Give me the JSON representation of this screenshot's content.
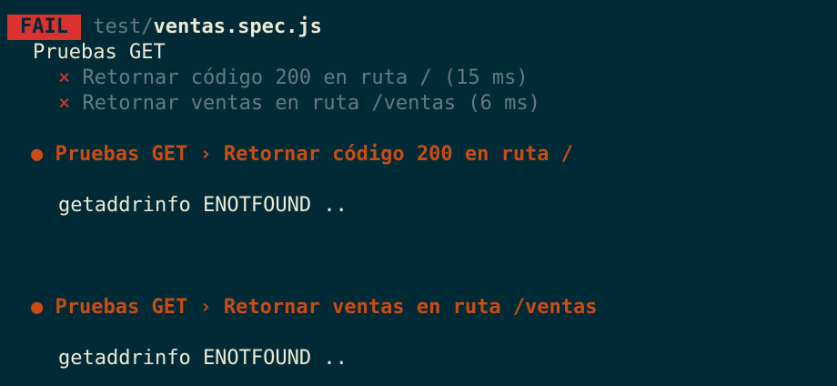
{
  "header": {
    "status_badge": "FAIL",
    "file_dir": "test/",
    "file_name": "ventas.spec.js"
  },
  "suite": {
    "title": "Pruebas GET",
    "tests": [
      {
        "mark": "×",
        "label": "Retornar código 200 en ruta / (15 ms)"
      },
      {
        "mark": "×",
        "label": "Retornar ventas en ruta /ventas (6 ms)"
      }
    ]
  },
  "failures": [
    {
      "bullet": "●",
      "title": "Pruebas GET › Retornar código 200 en ruta /",
      "message": "getaddrinfo ENOTFOUND .."
    },
    {
      "bullet": "●",
      "title": "Pruebas GET › Retornar ventas en ruta /ventas",
      "message": "getaddrinfo ENOTFOUND .."
    }
  ],
  "colors": {
    "background": "#002b36",
    "fail_badge": "#dc322f",
    "failure_title": "#cb4b16",
    "dim_text": "#657b83"
  }
}
